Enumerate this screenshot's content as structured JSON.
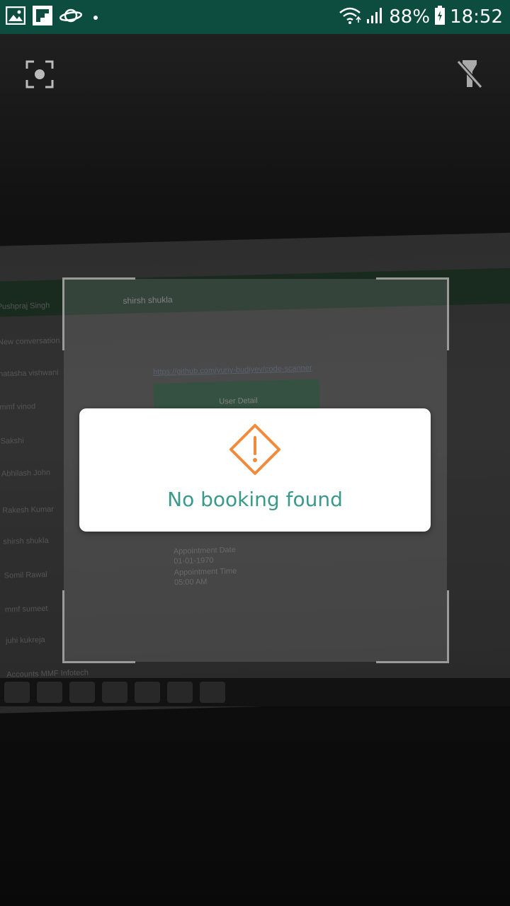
{
  "status_bar": {
    "battery": "88%",
    "time": "18:52",
    "icons": [
      "gallery-icon",
      "flipboard-icon",
      "saturn-icon",
      "dot-icon",
      "wifi-icon",
      "signal-icon",
      "battery-icon"
    ]
  },
  "camera": {
    "toolbar": {
      "focus_icon": "focus-icon",
      "flash_icon": "flash-off-icon"
    },
    "background_text": {
      "chat_header": "shirsh shukla",
      "contact_top": "Pushpraj Singh",
      "new_conversation": "New conversation",
      "link": "https://github.com/yuriy-budiyev/code-scanner",
      "user_detail": "User Detail",
      "contacts": [
        "natasha vishwani",
        "mmf vinod",
        "Sakshi",
        "Abhilash John",
        "Rakesh Kumar",
        "shirsh shukla",
        "Somil Rawal",
        "mmf sumeet",
        "juhi kukreja",
        "Accounts MMF Infotech"
      ],
      "appointment_date_label": "Appointment Date",
      "appointment_date": "01-01-1970",
      "appointment_time_label": "Appointment Time",
      "appointment_time": "05:00 AM"
    }
  },
  "dialog": {
    "icon": "warning-icon",
    "message": "No booking found",
    "accent": "#f08a3c",
    "text_color": "#3a9a8a"
  }
}
